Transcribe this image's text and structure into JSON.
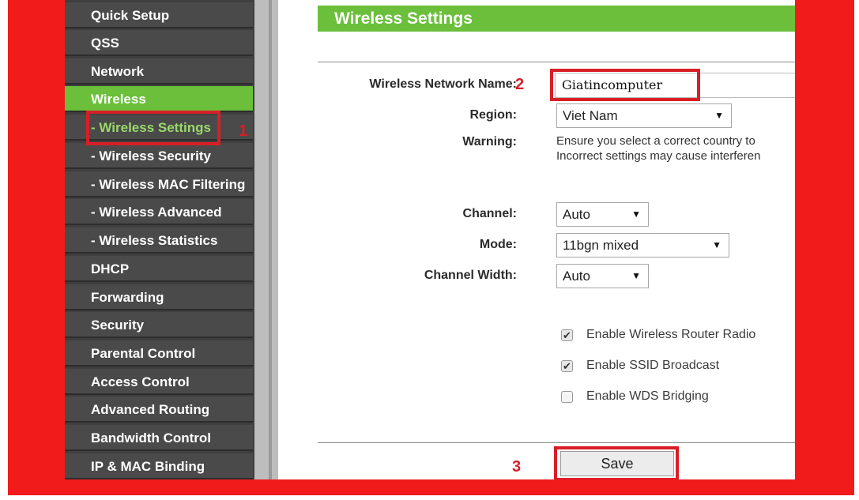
{
  "sidebar": {
    "items": [
      {
        "label": "Quick Setup"
      },
      {
        "label": "QSS"
      },
      {
        "label": "Network"
      },
      {
        "label": "Wireless",
        "active": true
      },
      {
        "label": "- Wireless Settings",
        "sub": true,
        "current": true
      },
      {
        "label": "- Wireless Security",
        "sub": true
      },
      {
        "label": "- Wireless MAC Filtering",
        "sub": true
      },
      {
        "label": "- Wireless Advanced",
        "sub": true
      },
      {
        "label": "- Wireless Statistics",
        "sub": true
      },
      {
        "label": "DHCP"
      },
      {
        "label": "Forwarding"
      },
      {
        "label": "Security"
      },
      {
        "label": "Parental Control"
      },
      {
        "label": "Access Control"
      },
      {
        "label": "Advanced Routing"
      },
      {
        "label": "Bandwidth Control"
      },
      {
        "label": "IP & MAC Binding"
      }
    ]
  },
  "header": {
    "title": "Wireless Settings"
  },
  "form": {
    "network_name_label": "Wireless Network Name:",
    "network_name_value": "Giatincomputer",
    "region_label": "Region:",
    "region_value": "Viet Nam",
    "warning_label": "Warning:",
    "warning_line1": "Ensure you select a correct country to",
    "warning_line2": "Incorrect settings may cause interferen",
    "channel_label": "Channel:",
    "channel_value": "Auto",
    "mode_label": "Mode:",
    "mode_value": "11bgn mixed",
    "channel_width_label": "Channel Width:",
    "channel_width_value": "Auto",
    "checkboxes": [
      {
        "label": "Enable Wireless Router Radio",
        "checked": true
      },
      {
        "label": "Enable SSID Broadcast",
        "checked": true
      },
      {
        "label": "Enable WDS Bridging",
        "checked": false
      }
    ],
    "save_label": "Save"
  },
  "annotations": {
    "step1": "1",
    "step2": "2",
    "step3": "3",
    "highlight_color": "#d81e27"
  },
  "colors": {
    "accent_green": "#6bbf3b",
    "frame_red": "#f21b1b",
    "sidebar_dark": "#4a4a4a"
  },
  "icons": {
    "caret": "▼",
    "check": "✔"
  }
}
